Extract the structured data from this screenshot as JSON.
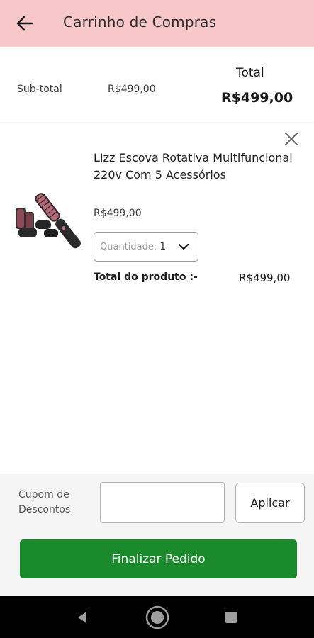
{
  "header": {
    "title": "Carrinho de Compras",
    "back_icon": "arrow-left-icon",
    "background": "#f7c7c9"
  },
  "summary": {
    "subtotal_label": "Sub-total",
    "subtotal_value": "R$499,00",
    "total_label": "Total",
    "total_value": "R$499,00"
  },
  "product": {
    "name": "LIzz Escova Rotativa Multifuncional 220v Com 5 Acessórios",
    "price": "R$499,00",
    "quantity_label": "Quantidade:",
    "quantity_value": "1",
    "total_label": "Total do produto :-",
    "total_value": "R$499,00",
    "remove_icon": "close-icon"
  },
  "coupon": {
    "label": "Cupom de Descontos",
    "input_value": "",
    "apply_label": "Aplicar"
  },
  "checkout": {
    "label": "Finalizar Pedido",
    "color": "#1b8a2c"
  },
  "system_nav": {
    "icons": [
      "back-triangle-icon",
      "home-circle-icon",
      "recents-square-icon"
    ]
  }
}
